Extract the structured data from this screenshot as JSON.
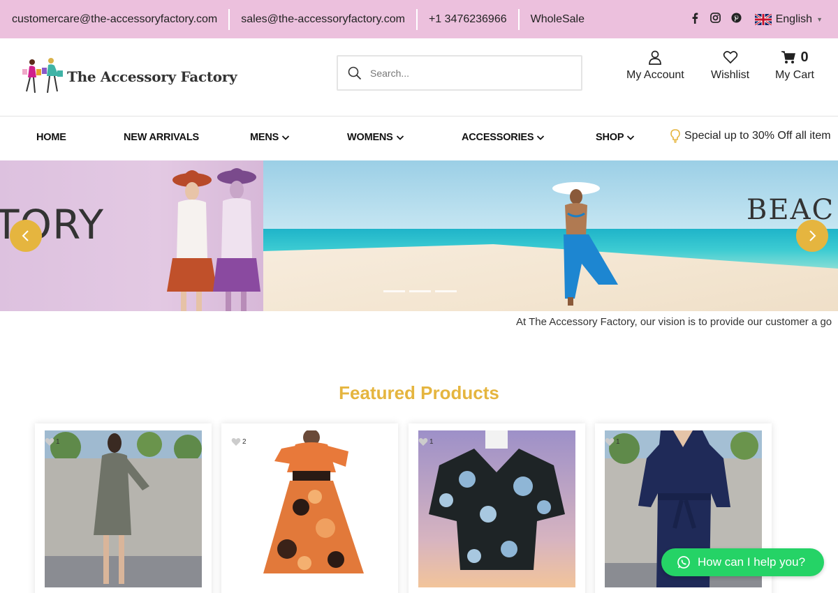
{
  "topbar": {
    "email_care": "customercare@the-accessoryfactory.com",
    "email_sales": "sales@the-accessoryfactory.com",
    "phone": "+1 3476236966",
    "wholesale": "WholeSale",
    "social": [
      "facebook-icon",
      "instagram-icon",
      "pinterest-icon"
    ],
    "language": "English"
  },
  "header": {
    "logo_text": "The Accessory Factory",
    "search_placeholder": "Search...",
    "account_label": "My Account",
    "wishlist_label": "Wishlist",
    "cart_label": "My Cart",
    "cart_count": "0"
  },
  "nav": {
    "items": [
      {
        "label": "HOME"
      },
      {
        "label": "NEW ARRIVALS"
      },
      {
        "label": "MENS"
      },
      {
        "label": "WOMENS"
      },
      {
        "label": "ACCESSORIES"
      },
      {
        "label": "SHOP"
      }
    ],
    "promo": "Special up to 30% Off all item"
  },
  "slider": {
    "left_text": "TORY",
    "right_text": "BEAC"
  },
  "marquee": "At The Accessory Factory, our vision is to provide our customer a go",
  "featured": {
    "title": "Featured Products",
    "products": [
      {
        "wish_count": "1"
      },
      {
        "wish_count": "2"
      },
      {
        "wish_count": "1"
      },
      {
        "wish_count": "1"
      }
    ]
  },
  "whatsapp": {
    "label": "How can I help you?"
  },
  "colors": {
    "accent": "#e5b53f",
    "topbar": "#ecc0dd",
    "whatsapp": "#25d366"
  }
}
